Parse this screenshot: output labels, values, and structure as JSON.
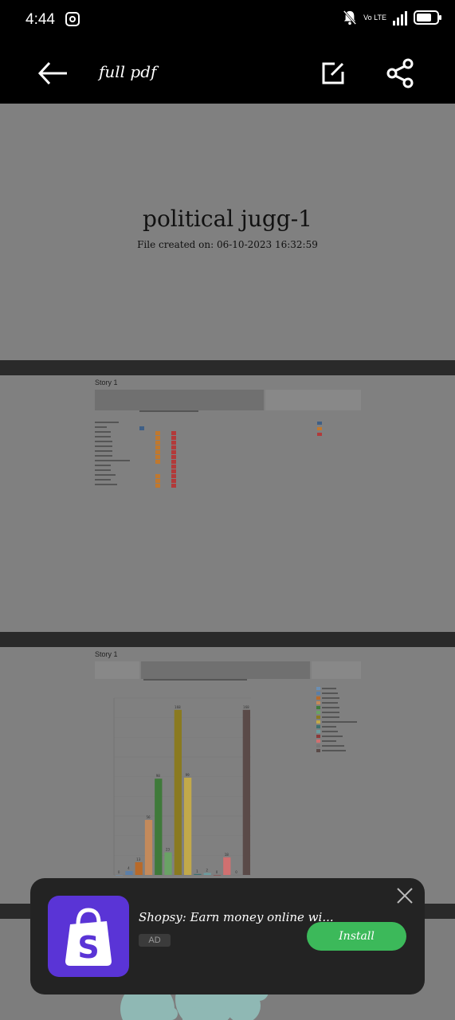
{
  "status_bar": {
    "time": "4:44",
    "network": "4G",
    "volte": "Vo LTE",
    "icons": [
      "instagram-icon",
      "mute-bell-icon",
      "signal-icon",
      "battery-icon"
    ]
  },
  "toolbar": {
    "title": "full pdf",
    "icons": [
      "back-arrow-icon",
      "edit-icon",
      "share-icon"
    ]
  },
  "document": {
    "cover": {
      "title": "political jugg-1",
      "created": "File created on: 06-10-2023 16:32:59"
    },
    "page2": {
      "story_label": "Story 1"
    },
    "page3": {
      "story_label": "Story 1",
      "chart_title": "Count of..."
    }
  },
  "ad": {
    "title": "Shopsy: Earn money online wi...",
    "badge": "AD",
    "install_label": "Install",
    "colors": {
      "icon_bg": "#5a34d6",
      "install_bg": "#3cb95a"
    }
  },
  "chart_data": {
    "type": "bar",
    "title": "",
    "categories": [
      "c1",
      "c2",
      "c3",
      "c4",
      "c5",
      "c6",
      "c7",
      "c8",
      "c9",
      "c10",
      "c11",
      "c12",
      "c13",
      "c14"
    ],
    "values": [
      0,
      4,
      13,
      56,
      98,
      23,
      168,
      99,
      1,
      2,
      0,
      18,
      0,
      168
    ],
    "colors": [
      "#6b8fb3",
      "#5b7fa8",
      "#b86a2a",
      "#c48a5b",
      "#3f7a3a",
      "#6aa265",
      "#8a7a20",
      "#c2a94a",
      "#3d6f6f",
      "#6c9da0",
      "#8b3a3a",
      "#d07070",
      "#777",
      "#5a4a48"
    ],
    "ylim": [
      0,
      180
    ]
  }
}
